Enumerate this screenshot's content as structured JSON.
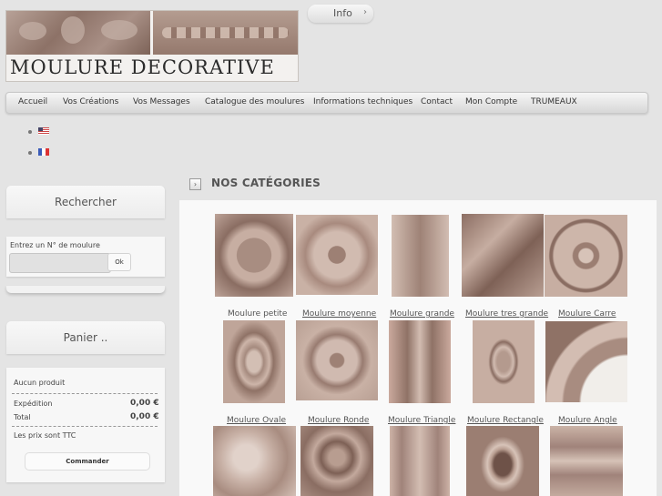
{
  "site": {
    "logo_text": "MOULURE DECORATIVE",
    "info_tab": "Info"
  },
  "nav": [
    "Accueil",
    "Vos Créations",
    "Vos Messages",
    "Catalogue des moulures",
    "Informations techniques",
    "Contact",
    "Mon Compte",
    "TRUMEAUX"
  ],
  "languages": [
    "English",
    "Français"
  ],
  "search": {
    "title": "Rechercher",
    "label": "Entrez un N° de moulure",
    "value": "",
    "button": "Ok"
  },
  "cart": {
    "title": "Panier ..",
    "empty": "Aucun produit",
    "shipping_label": "Expédition",
    "shipping_value": "0,00 €",
    "total_label": "Total",
    "total_value": "0,00 €",
    "tax_note": "Les prix sont TTC",
    "order_button": "Commander"
  },
  "categories": {
    "title": "NOS CATÉGORIES",
    "row1_captions": [
      "Moulure petite",
      "Moulure moyenne",
      "Moulure grande",
      "Moulure tres grande",
      "Moulure Carre"
    ],
    "row2_captions": [
      "Moulure Ovale",
      "Moulure Ronde",
      "Moulure Triangle",
      "Moulure Rectangle",
      "Moulure Angle"
    ]
  },
  "colors": {
    "wood_light": "#c7aea2",
    "wood_dark": "#8a6d62",
    "background": "#e4e4e4"
  }
}
